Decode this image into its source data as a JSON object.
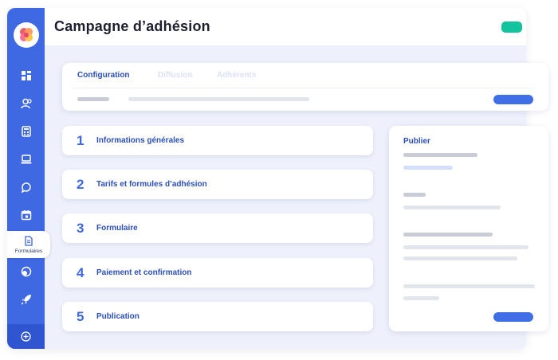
{
  "header": {
    "title": "Campagne d’adhésion"
  },
  "sidebar": {
    "items": [
      {
        "icon": "dashboard-icon"
      },
      {
        "icon": "users-icon"
      },
      {
        "icon": "calculator-icon"
      },
      {
        "icon": "laptop-icon"
      },
      {
        "icon": "chat-icon"
      },
      {
        "icon": "calendar-icon"
      },
      {
        "icon": "coins-icon"
      },
      {
        "icon": "rocket-icon"
      }
    ],
    "active_item": {
      "label": "Formulaires",
      "icon": "form-icon"
    },
    "bottom_icon": "add-icon"
  },
  "tabs": {
    "items": [
      {
        "label": "Configuration",
        "active": true
      },
      {
        "label": "Diffusion",
        "active": false
      },
      {
        "label": "Adhérents",
        "active": false
      }
    ]
  },
  "steps": [
    {
      "number": "1",
      "label": "Informations générales"
    },
    {
      "number": "2",
      "label": "Tarifs et formules d’adhésion"
    },
    {
      "number": "3",
      "label": "Formulaire"
    },
    {
      "number": "4",
      "label": "Paiement et confirmation"
    },
    {
      "number": "5",
      "label": "Publication"
    }
  ],
  "publish_panel": {
    "title": "Publier"
  },
  "colors": {
    "brand": "#3f68e3",
    "accent_green": "#12c39d",
    "text_blue": "#2b4fb8",
    "background": "#eef1fb"
  }
}
